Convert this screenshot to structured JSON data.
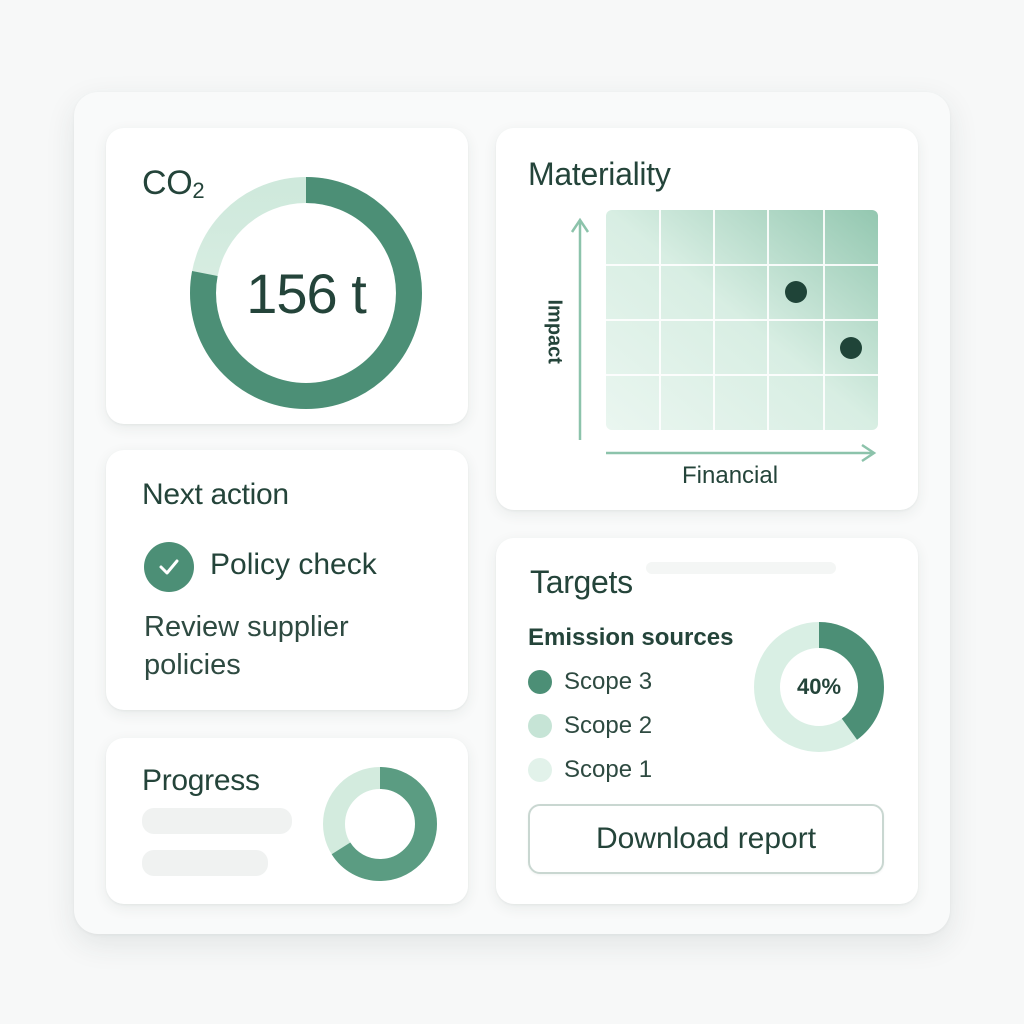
{
  "co2": {
    "label": "CO",
    "subscript": "2",
    "value": "156 t",
    "ring_progress": 0.78
  },
  "materiality": {
    "title": "Materiality",
    "y_axis": "Impact",
    "x_axis": "Financial"
  },
  "next_action": {
    "title": "Next action",
    "item_label": "Policy check",
    "description": "Review supplier policies"
  },
  "progress": {
    "title": "Progress",
    "ring_progress": 0.66
  },
  "targets": {
    "title": "Targets",
    "subtitle": "Emission sources",
    "legend": [
      {
        "label": "Scope 3",
        "color": "#4c8f76"
      },
      {
        "label": "Scope 2",
        "color": "#c6e4d6"
      },
      {
        "label": "Scope 1",
        "color": "#e2f2ea"
      }
    ],
    "donut_percent": "40%",
    "download_label": "Download report"
  },
  "colors": {
    "accent": "#4c8f76",
    "accent_light": "#c6e4d6",
    "accent_pale": "#e2f2ea",
    "text": "#24443a"
  }
}
